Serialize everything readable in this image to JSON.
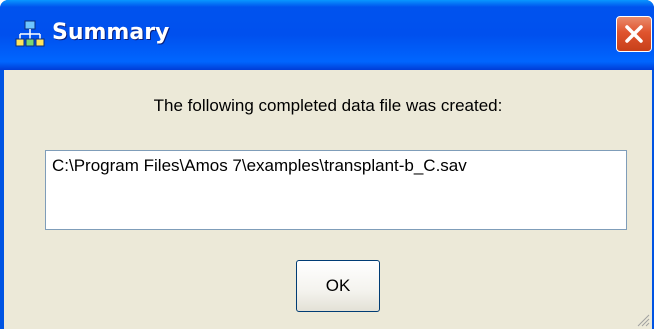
{
  "window": {
    "title": "Summary",
    "title_icon": "amos-app-icon",
    "close_icon": "close-icon"
  },
  "dialog": {
    "message": "The following completed data file was created:",
    "file_path": "C:\\Program Files\\Amos 7\\examples\\transplant-b_C.sav",
    "ok_label": "OK"
  },
  "colors": {
    "titlebar": "#0054e3",
    "client_background": "#ece9d8",
    "close_button": "#e0542e",
    "field_border": "#7f9db9"
  }
}
